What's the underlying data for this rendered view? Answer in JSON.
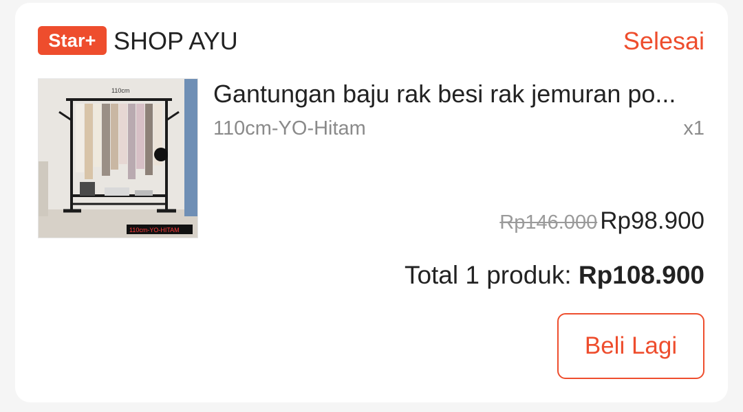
{
  "shop": {
    "badge": "Star+",
    "name": "SHOP AYU",
    "status": "Selesai"
  },
  "product": {
    "title": "Gantungan baju rak besi rak jemuran po...",
    "variant": "110cm-YO-Hitam",
    "quantity": "x1",
    "original_price": "Rp146.000",
    "price": "Rp98.900",
    "image_caption": "110cm-YO-HITAM",
    "image_size_label": "110cm"
  },
  "order": {
    "total_label": "Total 1 produk:",
    "total_value": "Rp108.900"
  },
  "actions": {
    "buy_again": "Beli Lagi"
  },
  "colors": {
    "accent": "#ee4d2d"
  }
}
